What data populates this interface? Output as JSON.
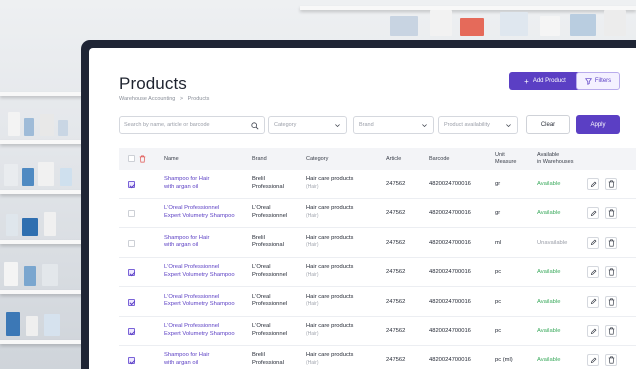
{
  "page": {
    "title": "Products"
  },
  "breadcrumb": [
    "Warehouse Accounting",
    ">",
    "Products"
  ],
  "toolbar": {
    "add_label": "Add Product",
    "filters_label": "Filters",
    "clear_label": "Clear",
    "apply_label": "Apply"
  },
  "filters": {
    "search_placeholder": "Search by name, article or barcode",
    "category_placeholder": "Category",
    "brand_placeholder": "Brand",
    "availability_placeholder": "Product availability"
  },
  "table": {
    "headers": {
      "name": "Name",
      "brand": "Brand",
      "category": "Category",
      "article": "Article",
      "barcode": "Barcode",
      "unit_line1": "Unit",
      "unit_line2": "Measure",
      "available_line1": "Available",
      "available_line2": "in Warehouses"
    },
    "rows": [
      {
        "checked": true,
        "name1": "Shampoo for Hair",
        "name2": "with argan oil",
        "brand1": "Brelil",
        "brand2": "Professional",
        "category": "Hair care products",
        "category_sub": "(Hair)",
        "article": "247562",
        "barcode": "4820024700016",
        "unit": "gr",
        "availability": "Available"
      },
      {
        "checked": false,
        "name1": "L'Oreal Professionnel",
        "name2": "Expert Volumetry Shampoo",
        "brand1": "L'Oreal",
        "brand2": "Professionnel",
        "category": "Hair care products",
        "category_sub": "(Hair)",
        "article": "247562",
        "barcode": "4820024700016",
        "unit": "gr",
        "availability": "Available"
      },
      {
        "checked": false,
        "name1": "Shampoo for Hair",
        "name2": "with argan oil",
        "brand1": "Brelil",
        "brand2": "Professional",
        "category": "Hair care products",
        "category_sub": "(Hair)",
        "article": "247562",
        "barcode": "4820024700016",
        "unit": "ml",
        "availability": "Unavailable"
      },
      {
        "checked": true,
        "name1": "L'Oreal Professionnel",
        "name2": "Expert Volumetry Shampoo",
        "brand1": "L'Oreal",
        "brand2": "Professionnel",
        "category": "Hair care products",
        "category_sub": "(Hair)",
        "article": "247562",
        "barcode": "4820024700016",
        "unit": "pc",
        "availability": "Available"
      },
      {
        "checked": true,
        "name1": "L'Oreal Professionnel",
        "name2": "Expert Volumetry Shampoo",
        "brand1": "L'Oreal",
        "brand2": "Professionnel",
        "category": "Hair care products",
        "category_sub": "(Hair)",
        "article": "247562",
        "barcode": "4820024700016",
        "unit": "pc",
        "availability": "Available"
      },
      {
        "checked": true,
        "name1": "L'Oreal Professionnel",
        "name2": "Expert Volumetry Shampoo",
        "brand1": "L'Oreal",
        "brand2": "Professionnel",
        "category": "Hair care products",
        "category_sub": "(Hair)",
        "article": "247562",
        "barcode": "4820024700016",
        "unit": "pc",
        "availability": "Available"
      },
      {
        "checked": true,
        "name1": "Shampoo for Hair",
        "name2": "with argan oil",
        "brand1": "Brelil",
        "brand2": "Professional",
        "category": "Hair care products",
        "category_sub": "(Hair)",
        "article": "247562",
        "barcode": "4820024700016",
        "unit": "pc (ml)",
        "availability": "Available"
      }
    ]
  },
  "colors": {
    "accent": "#5b3fc4",
    "available": "#3caa5e",
    "frame": "#1f2535"
  }
}
